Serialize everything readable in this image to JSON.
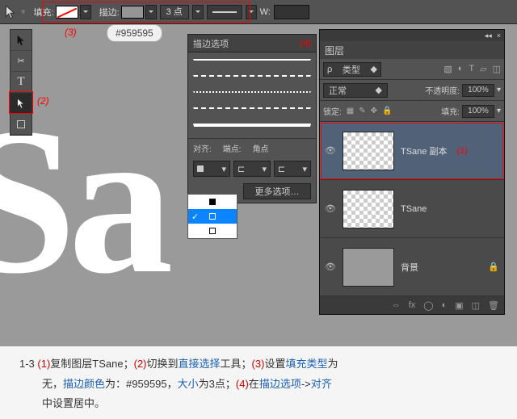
{
  "topbar": {
    "fill_label": "填充:",
    "stroke_label": "描边:",
    "stroke_size": "3 点",
    "w_label": "W:"
  },
  "hex_tooltip": "#959595",
  "annotations": {
    "a1": "(1)",
    "a2": "(2)",
    "a3": "(3)",
    "a4": "(4)"
  },
  "stroke_panel": {
    "title": "描边选项",
    "align_label": "对齐:",
    "cap_label": "端点:",
    "corner_label": "角点",
    "more": "更多选项…"
  },
  "layers": {
    "tab": "图层",
    "type": "类型",
    "blend": "正常",
    "opacity_label": "不透明度:",
    "opacity_val": "100%",
    "lock_label": "锁定:",
    "fill_label": "填充:",
    "fill_val": "100%",
    "items": [
      {
        "name": "TSane 副本"
      },
      {
        "name": "TSane"
      },
      {
        "name": "背景"
      }
    ]
  },
  "caption": {
    "line1_a": "1-3  ",
    "c1": "(1)",
    "line1_b": "复制图层TSane；",
    "c2": "(2)",
    "line1_c": "切换到",
    "blue1": "直接选择",
    "line1_d": "工具；",
    "c3": "(3)",
    "line1_e": "设置",
    "blue2": "填充类型",
    "line1_f": "为",
    "line2_a": "无，",
    "blue3": "描边颜色",
    "line2_b": "为：#959595，",
    "blue4": "大小",
    "line2_c": "为3点；",
    "c4": "(4)",
    "line2_d": "在",
    "blue5": "描边选项",
    "line2_e": "->",
    "blue6": "对齐",
    "line3": "中设置居中。"
  },
  "canvas_text": "Sa"
}
